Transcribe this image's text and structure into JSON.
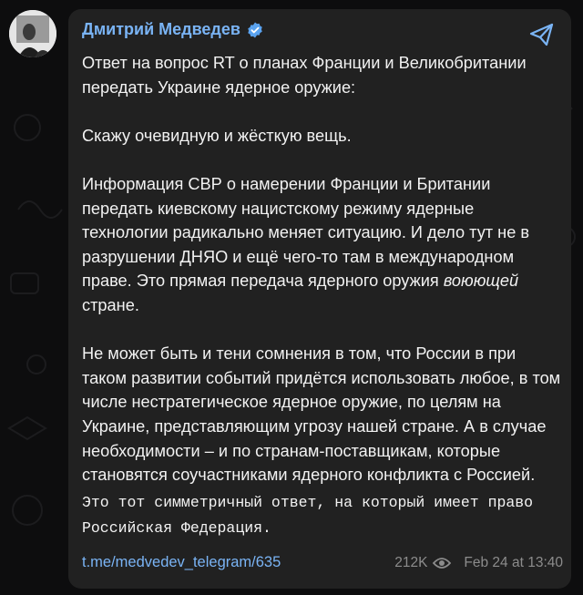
{
  "channel": {
    "name": "Дмитрий Медведев",
    "verified": true,
    "accent_color": "#7ab4f5"
  },
  "message": {
    "intro": "Ответ на вопрос RT о планах Франции и Великобритании передать Украине ядерное оружие:",
    "line1": "Скажу очевидную и жёсткую вещь.",
    "para2_before": "Информация СВР о намерении Франции и Британии передать киевскому нацистскому режиму ядерные технологии радикально меняет ситуацию. И дело тут не в разрушении ДНЯО и ещё чего-то там в международном праве. Это прямая передача ядерного оружия ",
    "para2_italic": "воюющей",
    "para2_after": " стране.",
    "para3_normal": "Не может быть и тени сомнения в том, что России в при таком развитии событий придётся использовать любое, в том числе нестратегическое ядерное оружие, по целям на Украине, представляющим угрозу нашей стране. А в случае необходимости – и по странам-поставщикам, которые становятся соучастниками ядерного конфликта с Россией.",
    "para3_mono": " Это тот симметричный ответ, на который имеет право Российская Федерация."
  },
  "footer": {
    "link": "t.me/medvedev_telegram/635",
    "views": "212K",
    "timestamp": "Feb 24 at 13:40"
  },
  "icons": {
    "share": "share-icon",
    "views": "eye-icon",
    "verified": "verified-badge-icon"
  }
}
